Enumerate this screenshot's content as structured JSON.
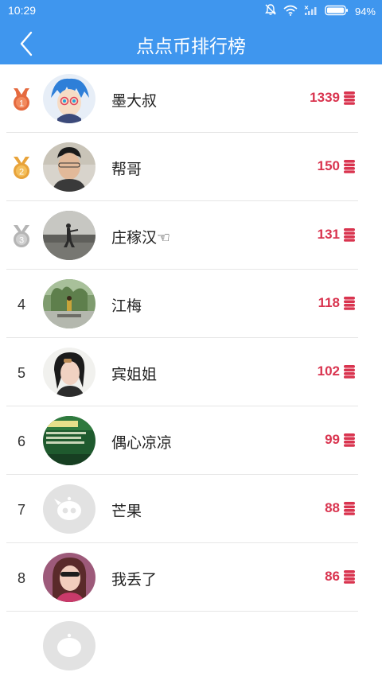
{
  "status": {
    "time": "10:29",
    "battery": "94%"
  },
  "header": {
    "title": "点点币排行榜"
  },
  "colors": {
    "brand": "#3f96ee",
    "score": "#d9344f",
    "gold": "#e8a33a",
    "bronze": "#e56a3f",
    "silver": "#b5b5b5"
  },
  "rankings": [
    {
      "rank": "1",
      "name": "墨大叔",
      "score": "1339",
      "medal": "gold"
    },
    {
      "rank": "2",
      "name": "帮哥",
      "score": "150",
      "medal": "silver"
    },
    {
      "rank": "3",
      "name": "庄稼汉☜",
      "score": "131",
      "medal": "bronze"
    },
    {
      "rank": "4",
      "name": "江梅",
      "score": "118"
    },
    {
      "rank": "5",
      "name": "宾姐姐",
      "score": "102"
    },
    {
      "rank": "6",
      "name": "偶心凉凉",
      "score": "99"
    },
    {
      "rank": "7",
      "name": "芒果",
      "score": "88"
    },
    {
      "rank": "8",
      "name": "我丢了",
      "score": "86"
    },
    {
      "rank": "",
      "name": "",
      "score": ""
    }
  ]
}
